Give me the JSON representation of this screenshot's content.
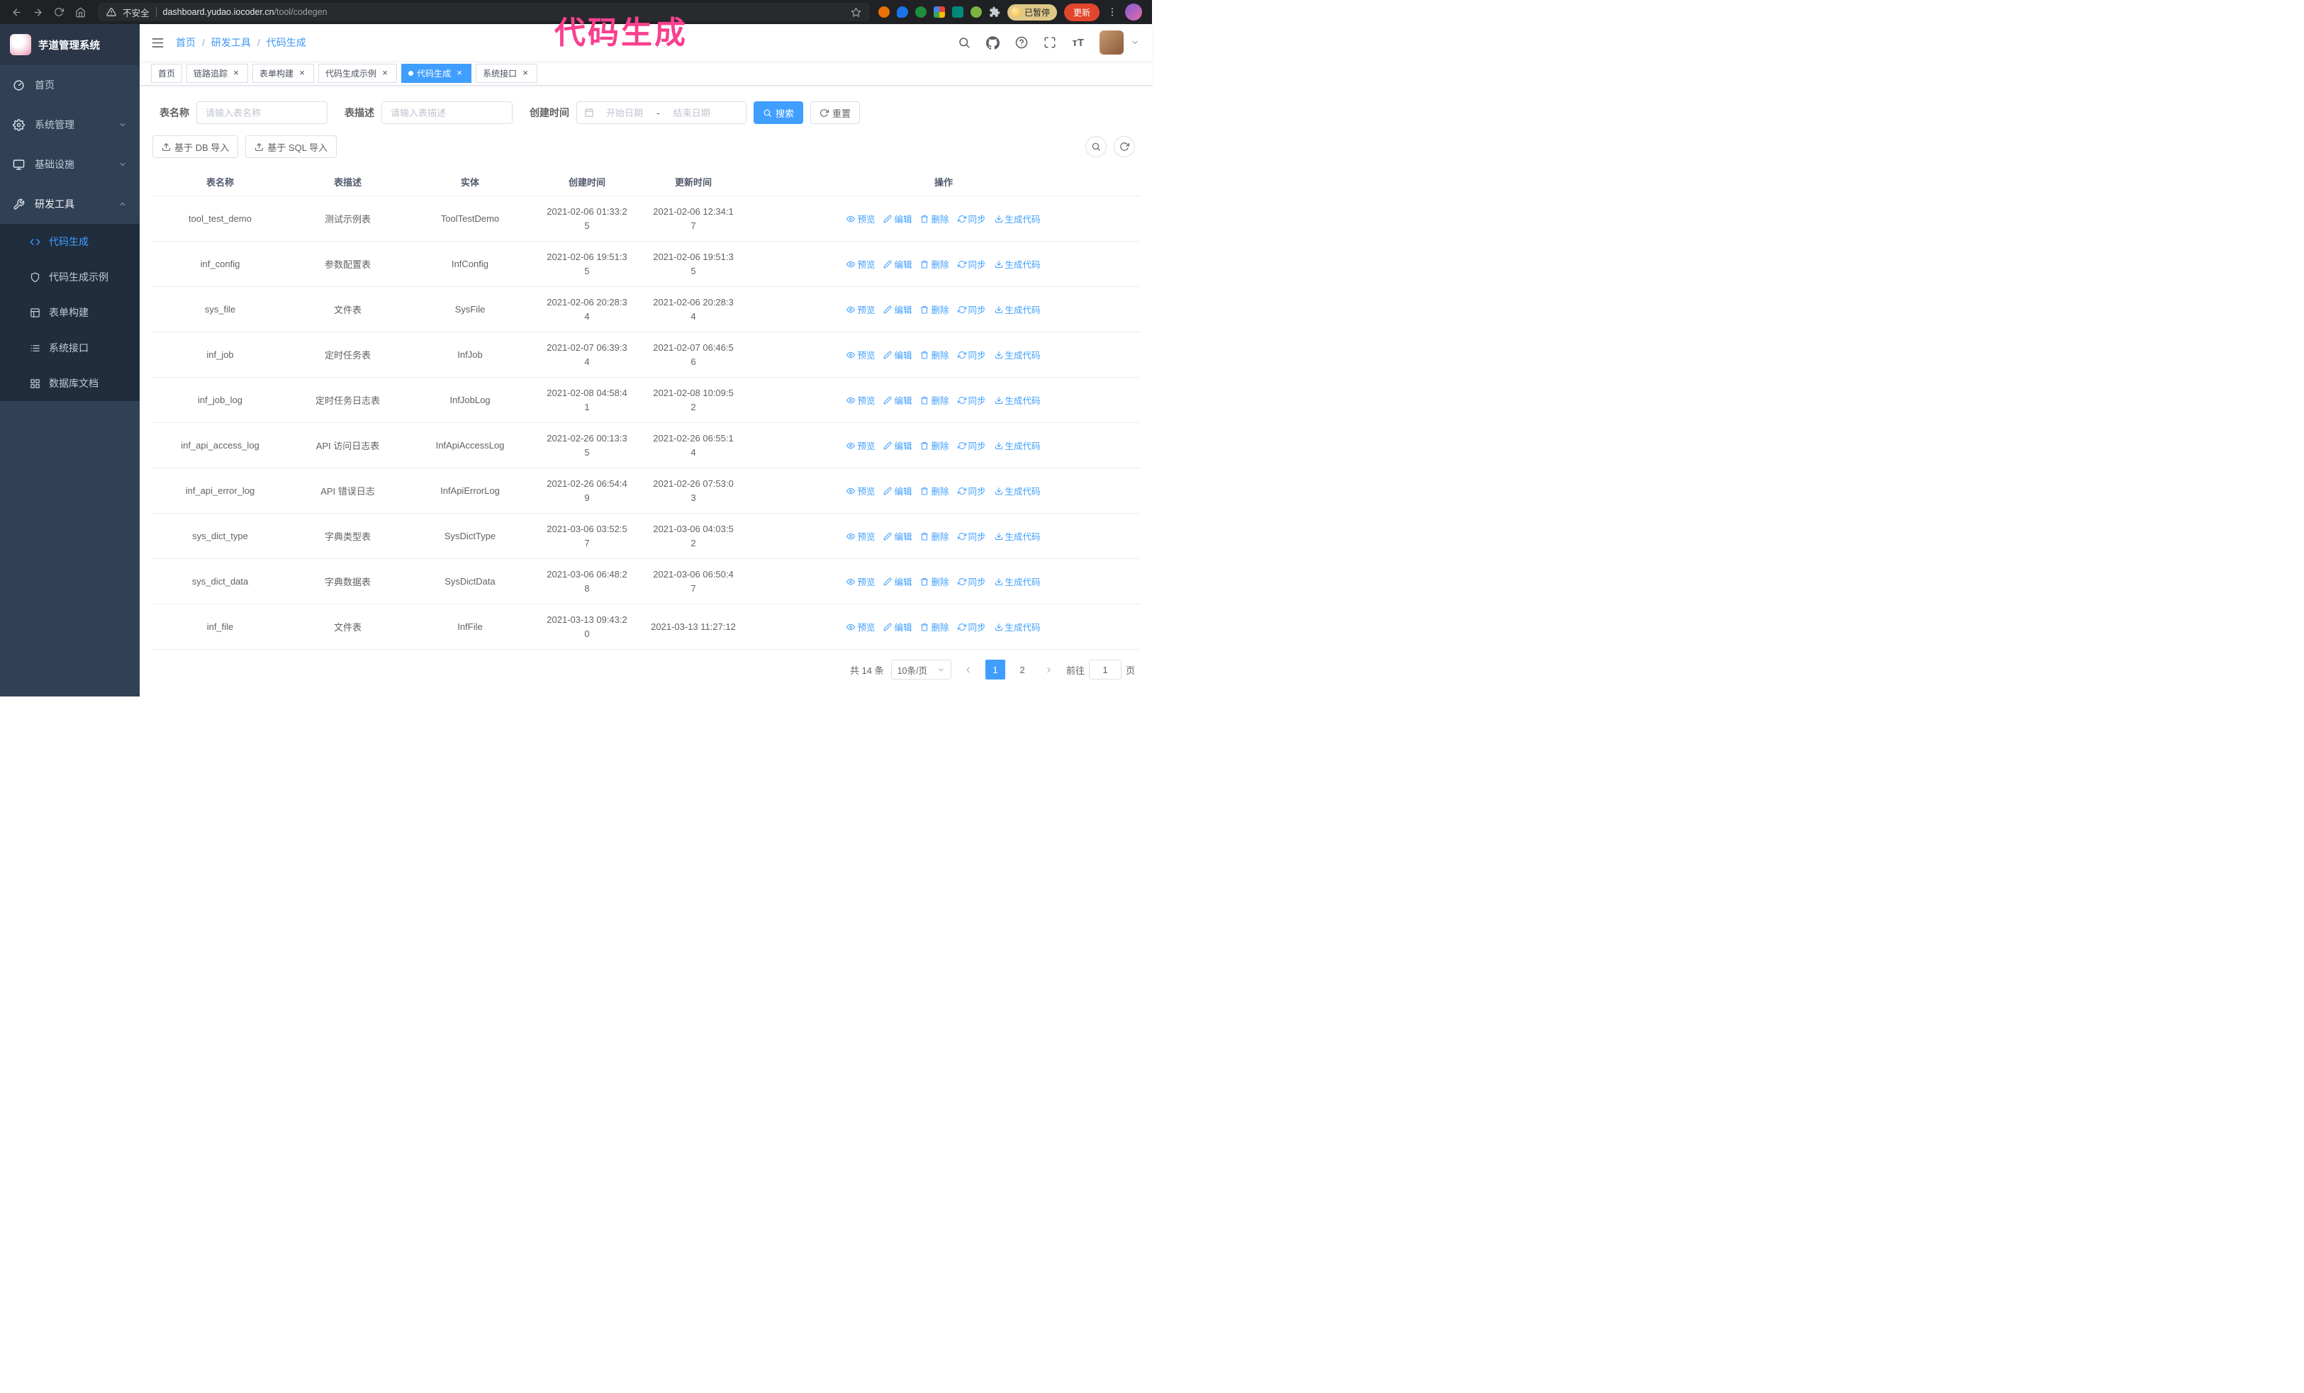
{
  "theme": {
    "accent": "#409eff",
    "sidebar_bg": "#304156",
    "submenu_bg": "#1f2d3d",
    "tag_active_bg": "#409eff",
    "annotation_color": "#f8408f"
  },
  "annotation": {
    "text": "代码生成"
  },
  "browser": {
    "security_label": "不安全",
    "url_domain": "dashboard.yudao.iocoder.cn",
    "url_path": "/tool/codegen",
    "paused_badge": "已暂停",
    "update_button": "更新"
  },
  "sidebar": {
    "logo_title": "芋道管理系统",
    "items": [
      {
        "label": "首页"
      },
      {
        "label": "系统管理"
      },
      {
        "label": "基础设施"
      },
      {
        "label": "研发工具"
      }
    ],
    "subitems": [
      {
        "label": "代码生成"
      },
      {
        "label": "代码生成示例"
      },
      {
        "label": "表单构建"
      },
      {
        "label": "系统接口"
      },
      {
        "label": "数据库文档"
      }
    ]
  },
  "header": {
    "breadcrumb": [
      "首页",
      "研发工具",
      "代码生成"
    ]
  },
  "tabs": [
    {
      "label": "首页"
    },
    {
      "label": "链路追踪"
    },
    {
      "label": "表单构建"
    },
    {
      "label": "代码生成示例"
    },
    {
      "label": "代码生成"
    },
    {
      "label": "系统接口"
    }
  ],
  "filters": {
    "name_label": "表名称",
    "name_placeholder": "请输入表名称",
    "desc_label": "表描述",
    "desc_placeholder": "请输入表描述",
    "time_label": "创建时间",
    "start_placeholder": "开始日期",
    "range_separator": "-",
    "end_placeholder": "结束日期",
    "search_button": "搜索",
    "reset_button": "重置"
  },
  "toolbar": {
    "import_db_button": "基于 DB 导入",
    "import_sql_button": "基于 SQL 导入"
  },
  "icons": {
    "navbar": [
      "search-icon",
      "github-icon",
      "help-icon",
      "fullscreen-icon",
      "font-size-icon"
    ],
    "row_actions": [
      "eye-icon",
      "edit-icon",
      "delete-icon",
      "sync-icon",
      "download-icon"
    ]
  },
  "table": {
    "columns": [
      "表名称",
      "表描述",
      "实体",
      "创建时间",
      "更新时间",
      "操作"
    ],
    "actions": {
      "preview": "预览",
      "edit": "编辑",
      "delete": "删除",
      "sync": "同步",
      "generate": "生成代码"
    },
    "rows": [
      {
        "name": "tool_test_demo",
        "desc": "测试示例表",
        "entity": "ToolTestDemo",
        "created": "2021-02-06 01:33:25",
        "updated": "2021-02-06 12:34:17"
      },
      {
        "name": "inf_config",
        "desc": "参数配置表",
        "entity": "InfConfig",
        "created": "2021-02-06 19:51:35",
        "updated": "2021-02-06 19:51:35"
      },
      {
        "name": "sys_file",
        "desc": "文件表",
        "entity": "SysFile",
        "created": "2021-02-06 20:28:34",
        "updated": "2021-02-06 20:28:34"
      },
      {
        "name": "inf_job",
        "desc": "定时任务表",
        "entity": "InfJob",
        "created": "2021-02-07 06:39:34",
        "updated": "2021-02-07 06:46:56"
      },
      {
        "name": "inf_job_log",
        "desc": "定时任务日志表",
        "entity": "InfJobLog",
        "created": "2021-02-08 04:58:41",
        "updated": "2021-02-08 10:09:52"
      },
      {
        "name": "inf_api_access_log",
        "desc": "API 访问日志表",
        "entity": "InfApiAccessLog",
        "created": "2021-02-26 00:13:35",
        "updated": "2021-02-26 06:55:14"
      },
      {
        "name": "inf_api_error_log",
        "desc": "API 错误日志",
        "entity": "InfApiErrorLog",
        "created": "2021-02-26 06:54:49",
        "updated": "2021-02-26 07:53:03"
      },
      {
        "name": "sys_dict_type",
        "desc": "字典类型表",
        "entity": "SysDictType",
        "created": "2021-03-06 03:52:57",
        "updated": "2021-03-06 04:03:52"
      },
      {
        "name": "sys_dict_data",
        "desc": "字典数据表",
        "entity": "SysDictData",
        "created": "2021-03-06 06:48:28",
        "updated": "2021-03-06 06:50:47"
      },
      {
        "name": "inf_file",
        "desc": "文件表",
        "entity": "InfFile",
        "created": "2021-03-13 09:43:20",
        "updated": "2021-03-13 11:27:12"
      }
    ]
  },
  "pagination": {
    "total": "共 14 条",
    "page_size": "10条/页",
    "pages": [
      "1",
      "2"
    ],
    "active_page": "1",
    "goto_label": "前往",
    "goto_value": "1",
    "goto_suffix": "页"
  }
}
